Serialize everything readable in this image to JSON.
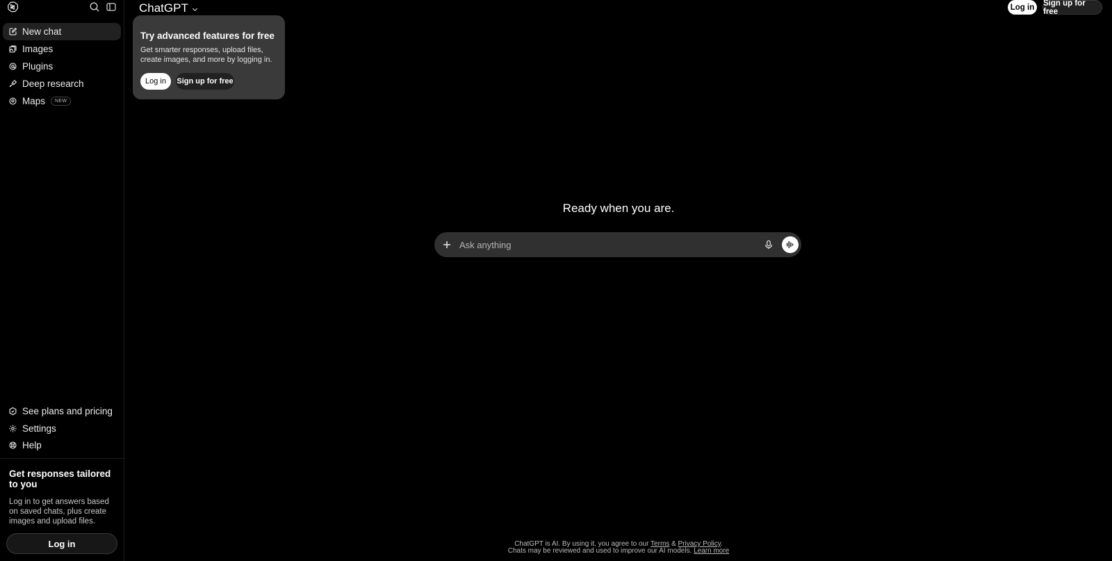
{
  "sidebar": {
    "items": [
      {
        "label": "New chat",
        "icon": "new-chat-icon",
        "active": true
      },
      {
        "label": "Images",
        "icon": "images-icon"
      },
      {
        "label": "Plugins",
        "icon": "plugins-icon"
      },
      {
        "label": "Deep research",
        "icon": "deep-research-icon"
      },
      {
        "label": "Maps",
        "icon": "map-pin-icon",
        "badge": "NEW"
      }
    ],
    "bottom_items": [
      {
        "label": "See plans and pricing",
        "icon": "plans-icon"
      },
      {
        "label": "Settings",
        "icon": "gear-icon"
      },
      {
        "label": "Help",
        "icon": "help-icon"
      }
    ],
    "tailored": {
      "title": "Get responses tailored to you",
      "body": "Log in to get answers based on saved chats, plus create images and upload files.",
      "login_label": "Log in"
    }
  },
  "header": {
    "model": "ChatGPT",
    "login_label": "Log in",
    "signup_label": "Sign up for free"
  },
  "promo": {
    "title": "Try advanced features for free",
    "body": "Get smarter responses, upload files, create images, and more by logging in.",
    "login_label": "Log in",
    "signup_label": "Sign up for free"
  },
  "main": {
    "headline": "Ready when you are.",
    "placeholder": "Ask anything"
  },
  "footer": {
    "line1_prefix": "ChatGPT is AI. By using it, you agree to our",
    "terms": "Terms",
    "amp": "&",
    "privacy": "Privacy Policy",
    "period": ".",
    "line2_prefix": "Chats may be reviewed and used to improve our AI models.",
    "learn_more": "Learn more"
  },
  "colors": {
    "background": "#000000",
    "surface": "#303030",
    "promo_card": "#3a3a3a",
    "text": "#ececec"
  }
}
